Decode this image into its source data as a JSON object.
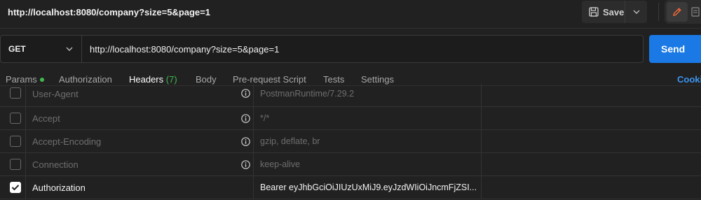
{
  "request": {
    "title": "http://localhost:8080/company?size=5&page=1",
    "method": "GET",
    "url": "http://localhost:8080/company?size=5&page=1"
  },
  "toolbar": {
    "save_label": "Save",
    "send_label": "Send"
  },
  "tabs": [
    {
      "label": "Params",
      "indicator": "green-dot"
    },
    {
      "label": "Authorization"
    },
    {
      "label": "Headers",
      "count": "(7)",
      "active": true
    },
    {
      "label": "Body"
    },
    {
      "label": "Pre-request Script"
    },
    {
      "label": "Tests"
    },
    {
      "label": "Settings"
    }
  ],
  "cookies_label": "Cooki",
  "headers": [
    {
      "key": "User-Agent",
      "value": "PostmanRuntime/7.29.2",
      "enabled": false
    },
    {
      "key": "Accept",
      "value": "*/*",
      "enabled": false
    },
    {
      "key": "Accept-Encoding",
      "value": "gzip, deflate, br",
      "enabled": false
    },
    {
      "key": "Connection",
      "value": "keep-alive",
      "enabled": false
    },
    {
      "key": "Authorization",
      "value": "Bearer eyJhbGciOiJIUzUxMiJ9.eyJzdWIiOiJncmFjZSI...",
      "enabled": true
    }
  ],
  "colors": {
    "accent_orange": "#ff6c37",
    "send_blue": "#1a79e5",
    "status_green": "#3fb950",
    "link_blue": "#3b94f0"
  }
}
